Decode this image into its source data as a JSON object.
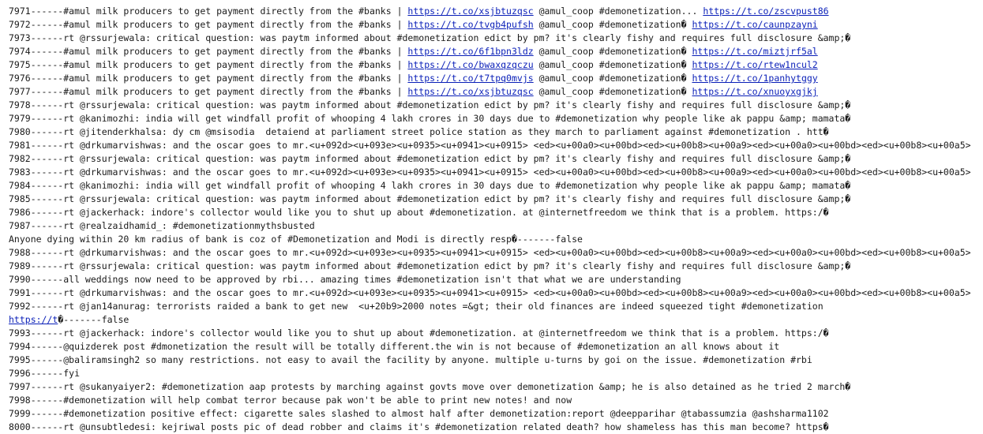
{
  "lines": [
    [
      {
        "t": "7971------#amul milk producers to get payment directly from the #banks | "
      },
      {
        "t": "https://t.co/xsjbtuzqsc",
        "link": true
      },
      {
        "t": " @amul_coop #demonetization... "
      },
      {
        "t": "https://t.co/zscvpust86",
        "link": true
      }
    ],
    [
      {
        "t": "7972------#amul milk producers to get payment directly from the #banks | "
      },
      {
        "t": "https://t.co/tvgb4pufsh",
        "link": true
      },
      {
        "t": " @amul_coop #demonetization� "
      },
      {
        "t": "https://t.co/caunpzayni",
        "link": true
      }
    ],
    [
      {
        "t": "7973------rt @rssurjewala: critical question: was paytm informed about #demonetization edict by pm? it's clearly fishy and requires full disclosure &amp;�"
      }
    ],
    [
      {
        "t": "7974------#amul milk producers to get payment directly from the #banks | "
      },
      {
        "t": "https://t.co/6f1bpn3ldz",
        "link": true
      },
      {
        "t": " @amul_coop #demonetization� "
      },
      {
        "t": "https://t.co/miztjrf5al",
        "link": true
      }
    ],
    [
      {
        "t": "7975------#amul milk producers to get payment directly from the #banks | "
      },
      {
        "t": "https://t.co/bwaxqzqczu",
        "link": true
      },
      {
        "t": " @amul_coop #demonetization� "
      },
      {
        "t": "https://t.co/rtew1ncul2",
        "link": true
      }
    ],
    [
      {
        "t": "7976------#amul milk producers to get payment directly from the #banks | "
      },
      {
        "t": "https://t.co/t7tpq0mvjs",
        "link": true
      },
      {
        "t": " @amul_coop #demonetization� "
      },
      {
        "t": "https://t.co/1panhytggy",
        "link": true
      }
    ],
    [
      {
        "t": "7977------#amul milk producers to get payment directly from the #banks | "
      },
      {
        "t": "https://t.co/xsjbtuzqsc",
        "link": true
      },
      {
        "t": " @amul_coop #demonetization� "
      },
      {
        "t": "https://t.co/xnuoyxgjkj",
        "link": true
      }
    ],
    [
      {
        "t": "7978------rt @rssurjewala: critical question: was paytm informed about #demonetization edict by pm? it's clearly fishy and requires full disclosure &amp;�"
      }
    ],
    [
      {
        "t": "7979------rt @kanimozhi: india will get windfall profit of whooping 4 lakh crores in 30 days due to #demonetization why people like ak pappu &amp; mamata�"
      }
    ],
    [
      {
        "t": "7980------rt @jitenderkhalsa: dy cm @msisodia  detaiend at parliament street police station as they march to parliament against #demonetization . htt�"
      }
    ],
    [
      {
        "t": "7981------rt @drkumarvishwas: and the oscar goes to mr.<u+092d><u+093e><u+0935><u+0941><u+0915> <ed><u+00a0><u+00bd><ed><u+00b8><u+00a9><ed><u+00a0><u+00bd><ed><u+00b8><u+00a5>"
      }
    ],
    [
      {
        "t": "7982------rt @rssurjewala: critical question: was paytm informed about #demonetization edict by pm? it's clearly fishy and requires full disclosure &amp;�"
      }
    ],
    [
      {
        "t": "7983------rt @drkumarvishwas: and the oscar goes to mr.<u+092d><u+093e><u+0935><u+0941><u+0915> <ed><u+00a0><u+00bd><ed><u+00b8><u+00a9><ed><u+00a0><u+00bd><ed><u+00b8><u+00a5>"
      }
    ],
    [
      {
        "t": "7984------rt @kanimozhi: india will get windfall profit of whooping 4 lakh crores in 30 days due to #demonetization why people like ak pappu &amp; mamata�"
      }
    ],
    [
      {
        "t": "7985------rt @rssurjewala: critical question: was paytm informed about #demonetization edict by pm? it's clearly fishy and requires full disclosure &amp;�"
      }
    ],
    [
      {
        "t": "7986------rt @jackerhack: indore's collector would like you to shut up about #demonetization. at @internetfreedom we think that is a problem. https:/�"
      }
    ],
    [
      {
        "t": "7987------rt @realzaidhamid_: #demonetizationmythsbusted"
      }
    ],
    [
      {
        "t": "Anyone dying within 20 km radius of bank is coz of #Demonetization and Modi is directly resp�-------false"
      }
    ],
    [
      {
        "t": "7988------rt @drkumarvishwas: and the oscar goes to mr.<u+092d><u+093e><u+0935><u+0941><u+0915> <ed><u+00a0><u+00bd><ed><u+00b8><u+00a9><ed><u+00a0><u+00bd><ed><u+00b8><u+00a5>"
      }
    ],
    [
      {
        "t": "7989------rt @rssurjewala: critical question: was paytm informed about #demonetization edict by pm? it's clearly fishy and requires full disclosure &amp;�"
      }
    ],
    [
      {
        "t": "7990------all weddings now need to be approved by rbi... amazing times #demonetization isn't that what we are understanding"
      }
    ],
    [
      {
        "t": "7991------rt @drkumarvishwas: and the oscar goes to mr.<u+092d><u+093e><u+0935><u+0941><u+0915> <ed><u+00a0><u+00bd><ed><u+00b8><u+00a9><ed><u+00a0><u+00bd><ed><u+00b8><u+00a5>"
      }
    ],
    [
      {
        "t": "7992------rt @jan14anurag: terrorists raided a bank to get new  <u+20b9>2000 notes =&gt; their old finances are indeed squeezed tight #demonetization"
      }
    ],
    [
      {
        "t": "https://t",
        "link": true
      },
      {
        "t": "�-------false"
      }
    ],
    [
      {
        "t": "7993------rt @jackerhack: indore's collector would like you to shut up about #demonetization. at @internetfreedom we think that is a problem. https:/�"
      }
    ],
    [
      {
        "t": "7994------@quizderek post #dmonetization the result will be totally different.the win is not because of #demonetization an all knows about it"
      }
    ],
    [
      {
        "t": "7995------@baliramsingh2 so many restrictions. not easy to avail the facility by anyone. multiple u-turns by goi on the issue. #demonetization #rbi"
      }
    ],
    [
      {
        "t": "7996------fyi"
      }
    ],
    [
      {
        "t": "7997------rt @sukanyaiyer2: #demonetization aap protests by marching against govts move over demonetization &amp; he is also detained as he tried 2 march�"
      }
    ],
    [
      {
        "t": "7998------#demonetization will help combat terror because pak won't be able to print new notes! and now"
      }
    ],
    [
      {
        "t": "7999------#demonetization positive effect: cigarette sales slashed to almost half after demonetization:report @deepparihar @tabassumzia @ashsharma1102"
      }
    ],
    [
      {
        "t": "8000------rt @unsubtledesi: kejriwal posts pic of dead robber and claims it's #demonetization related death? how shameless has this man become? https�"
      }
    ]
  ],
  "colors": {
    "text": "#1a1a1a",
    "link": "#0a1fb8",
    "background": "#ffffff"
  }
}
